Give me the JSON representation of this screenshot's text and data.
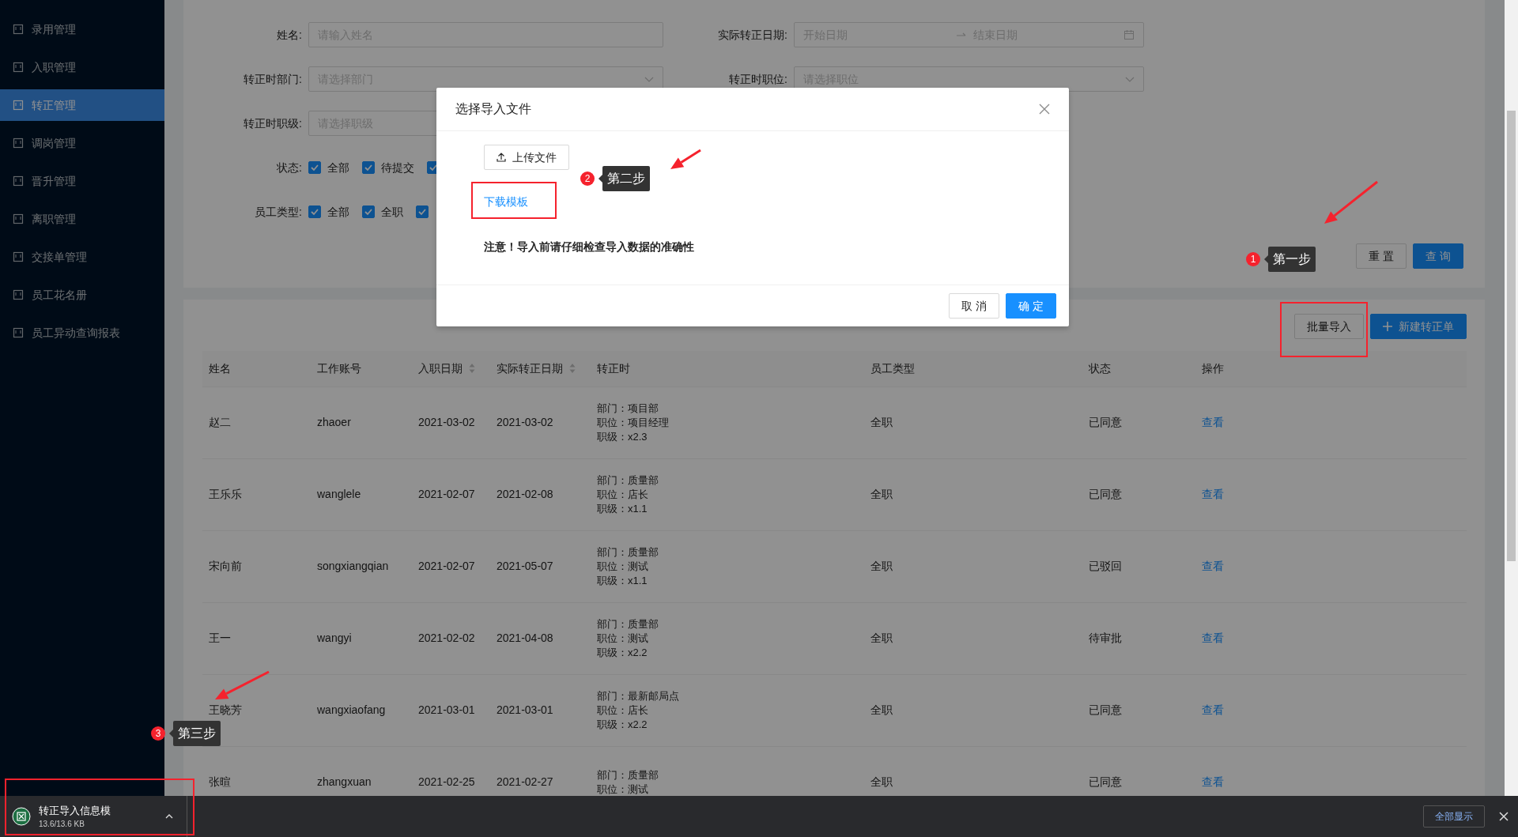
{
  "sidebar": {
    "items": [
      {
        "label": "录用管理",
        "selected": false
      },
      {
        "label": "入职管理",
        "selected": false
      },
      {
        "label": "转正管理",
        "selected": true
      },
      {
        "label": "调岗管理",
        "selected": false
      },
      {
        "label": "晋升管理",
        "selected": false
      },
      {
        "label": "离职管理",
        "selected": false
      },
      {
        "label": "交接单管理",
        "selected": false
      },
      {
        "label": "员工花名册",
        "selected": false
      },
      {
        "label": "员工异动查询报表",
        "selected": false
      }
    ]
  },
  "filters": {
    "name": {
      "label": "姓名:",
      "placeholder": "请输入姓名"
    },
    "actual_date": {
      "label": "实际转正日期:",
      "start_placeholder": "开始日期",
      "end_placeholder": "结束日期"
    },
    "department": {
      "label": "转正时部门:",
      "placeholder": "请选择部门"
    },
    "position": {
      "label": "转正时职位:",
      "placeholder": "请选择职位"
    },
    "grade": {
      "label": "转正时职级:",
      "placeholder": "请选择职级"
    },
    "status": {
      "label": "状态:",
      "options": [
        {
          "label": "全部",
          "checked": true
        },
        {
          "label": "待提交",
          "checked": true
        },
        {
          "checked": true
        }
      ]
    },
    "employee_type": {
      "label": "员工类型:",
      "options": [
        {
          "label": "全部",
          "checked": true
        },
        {
          "label": "全职",
          "checked": true
        },
        {
          "checked": true
        }
      ]
    },
    "buttons": [
      {
        "label": "重 置",
        "kind": "default"
      },
      {
        "label": "查 询",
        "kind": "primary"
      }
    ]
  },
  "toolbar": {
    "buttons": [
      {
        "label": "批量导入",
        "kind": "default"
      },
      {
        "label": "新建转正单",
        "kind": "primary"
      }
    ]
  },
  "table": {
    "columns": [
      {
        "label": "姓名",
        "sortable": false
      },
      {
        "label": "工作账号",
        "sortable": false
      },
      {
        "label": "入职日期",
        "sortable": true
      },
      {
        "label": "实际转正日期",
        "sortable": true
      },
      {
        "label": "转正时",
        "sortable": false
      },
      {
        "label": "员工类型",
        "sortable": false
      },
      {
        "label": "状态",
        "sortable": false
      },
      {
        "label": "操作",
        "sortable": false
      }
    ],
    "rows": [
      {
        "name": "赵二",
        "account": "zhaoer",
        "hire_date": "2021-03-02",
        "actual_date": "2021-03-02",
        "details": [
          "部门：项目部",
          "职位：项目经理",
          "职级：x2.3"
        ],
        "type": "全职",
        "status": "已同意",
        "action": "查看"
      },
      {
        "name": "王乐乐",
        "account": "wanglele",
        "hire_date": "2021-02-07",
        "actual_date": "2021-02-08",
        "details": [
          "部门：质量部",
          "职位：店长",
          "职级：x1.1"
        ],
        "type": "全职",
        "status": "已同意",
        "action": "查看"
      },
      {
        "name": "宋向前",
        "account": "songxiangqian",
        "hire_date": "2021-02-07",
        "actual_date": "2021-05-07",
        "details": [
          "部门：质量部",
          "职位：测试",
          "职级：x1.1"
        ],
        "type": "全职",
        "status": "已驳回",
        "action": "查看"
      },
      {
        "name": "王一",
        "account": "wangyi",
        "hire_date": "2021-02-02",
        "actual_date": "2021-04-08",
        "details": [
          "部门：质量部",
          "职位：测试",
          "职级：x2.2"
        ],
        "type": "全职",
        "status": "待审批",
        "action": "查看"
      },
      {
        "name": "王晓芳",
        "account": "wangxiaofang",
        "hire_date": "2021-03-01",
        "actual_date": "2021-03-01",
        "details": [
          "部门：最新邮局点",
          "职位：店长",
          "职级：x2.2"
        ],
        "type": "全职",
        "status": "已同意",
        "action": "查看"
      },
      {
        "name": "张暄",
        "account": "zhangxuan",
        "hire_date": "2021-02-25",
        "actual_date": "2021-02-27",
        "details": [
          "部门：质量部",
          "职位：测试"
        ],
        "type": "全职",
        "status": "已同意",
        "action": "查看"
      }
    ]
  },
  "modal": {
    "title": "选择导入文件",
    "upload_button": "上传文件",
    "template_link": "下载模板",
    "notice": "注意！导入前请仔细检查导入数据的准确性",
    "buttons": [
      {
        "label": "取 消",
        "kind": "default"
      },
      {
        "label": "确 定",
        "kind": "primary"
      }
    ]
  },
  "annotations": [
    {
      "number": "1",
      "label": "第一步"
    },
    {
      "number": "2",
      "label": "第二步"
    },
    {
      "number": "3",
      "label": "第三步"
    }
  ],
  "download_bar": {
    "file_name": "转正导入信息模",
    "size": "13.6/13.6 KB",
    "show_all": "全部显示"
  }
}
